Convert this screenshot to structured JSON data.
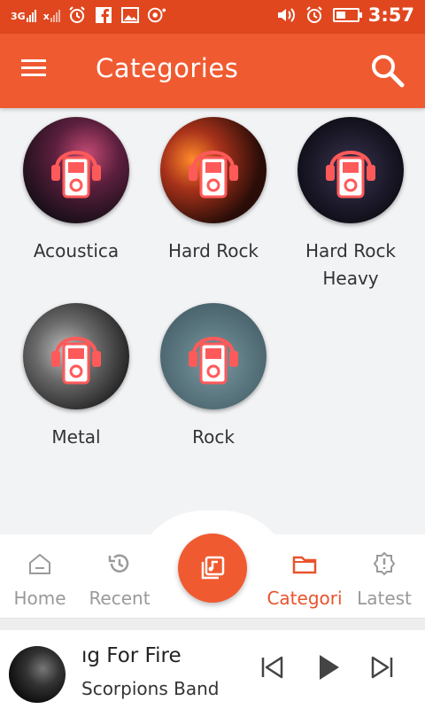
{
  "status_bar": {
    "network_1": "3G",
    "network_2": "x",
    "time": "3:57",
    "icons": [
      "signal-icon",
      "alarm-icon",
      "facebook-icon",
      "gallery-icon",
      "headset-icon",
      "volume-icon",
      "alarm-icon",
      "battery-charging-icon"
    ]
  },
  "app_bar": {
    "title": "Categories",
    "menu_icon": "hamburger-menu-icon",
    "search_icon": "search-icon"
  },
  "categories": [
    {
      "label": "Acoustica",
      "image": "concert-stage-image"
    },
    {
      "label": "Hard Rock",
      "image": "fire-skeleton-image"
    },
    {
      "label": "Hard Rock Heavy",
      "image": "motorcycle-wheel-image"
    },
    {
      "label": "Metal",
      "image": "metal-guitarist-image"
    },
    {
      "label": "Rock",
      "image": "rock-poster-image"
    }
  ],
  "bottom_nav": {
    "items": [
      {
        "label": "Home",
        "icon": "home-icon",
        "active": false
      },
      {
        "label": "Recent",
        "icon": "history-icon",
        "active": false
      },
      {
        "label": "",
        "icon": "music-library-icon",
        "active": false
      },
      {
        "label": "Categori",
        "icon": "folder-icon",
        "active": true
      },
      {
        "label": "Latest",
        "icon": "badge-alert-icon",
        "active": false
      }
    ]
  },
  "player": {
    "title": "ıg For Fire",
    "artist": "Scorpions Band",
    "controls": [
      "skip-previous-icon",
      "play-icon",
      "skip-next-icon"
    ]
  },
  "colors": {
    "status_bar": "#e0471f",
    "app_bar": "#f05a30",
    "accent": "#e8542d",
    "inactive": "#999999"
  }
}
